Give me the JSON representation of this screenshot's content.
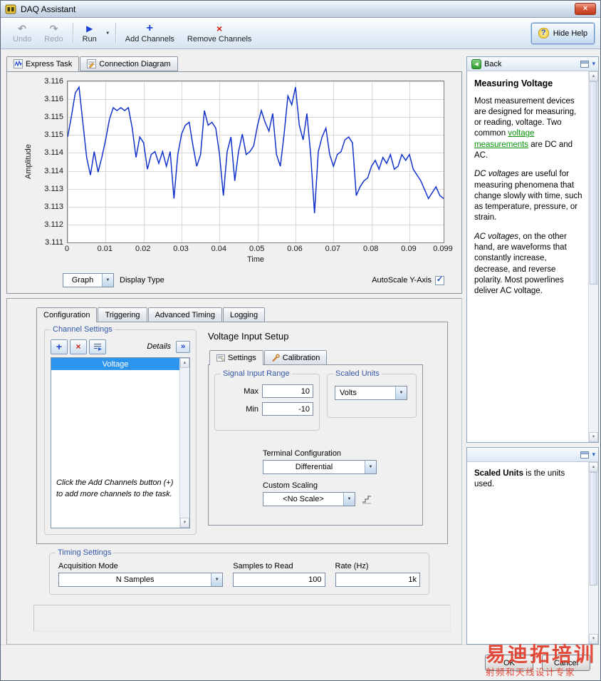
{
  "window": {
    "title": "DAQ Assistant"
  },
  "icons": {
    "undo": "↶",
    "redo": "↷",
    "run": "▶",
    "caret_down": "▼",
    "plus": "+",
    "x": "×",
    "question": "?",
    "back": "◀",
    "check": "✓",
    "chevron_collapse": "▾",
    "details_expand": "»",
    "close": "×",
    "scroll_up": "▲",
    "scroll_down": "▼"
  },
  "colors": {
    "selection_blue": "#2e95ef",
    "group_title_blue": "#3357a8",
    "link_green": "#089408",
    "chart_line_blue": "#1133cc",
    "watermark_red": "#e23220",
    "run_blue": "#1a3fd4",
    "remove_red": "#d02010"
  },
  "toolbar": {
    "undo": "Undo",
    "redo": "Redo",
    "run": "Run",
    "add_channels": "Add Channels",
    "remove_channels": "Remove Channels",
    "hide_help": "Hide Help"
  },
  "express_tabs": {
    "express_task": "Express Task",
    "connection_diagram": "Connection Diagram"
  },
  "graph": {
    "display_type_value": "Graph",
    "display_type_label": "Display Type",
    "autoscale_label": "AutoScale Y-Axis"
  },
  "chart_data": {
    "type": "line",
    "title": "",
    "xlabel": "Time",
    "ylabel": "Amplitude",
    "x_ticks": [
      "0",
      "0.01",
      "0.02",
      "0.03",
      "0.04",
      "0.05",
      "0.06",
      "0.07",
      "0.08",
      "0.09",
      "0.099"
    ],
    "y_ticks": [
      "3.116",
      "3.116",
      "3.115",
      "3.115",
      "3.114",
      "3.114",
      "3.113",
      "3.113",
      "3.112",
      "3.111"
    ],
    "xlim": [
      0,
      0.099
    ],
    "ylim": [
      3.111,
      3.1165
    ],
    "x_step": 0.001,
    "grid": true,
    "grid_color": "#d8d8d8",
    "line_color": "#1133cc",
    "legend": "none",
    "values": [
      3.1146,
      3.1153,
      3.1161,
      3.1163,
      3.1151,
      3.1139,
      3.1133,
      3.1141,
      3.1134,
      3.1139,
      3.1145,
      3.1152,
      3.1156,
      3.1155,
      3.1156,
      3.1155,
      3.1156,
      3.1149,
      3.1139,
      3.1146,
      3.1144,
      3.1135,
      3.114,
      3.1141,
      3.1137,
      3.1141,
      3.1136,
      3.1141,
      3.1125,
      3.114,
      3.1147,
      3.115,
      3.1151,
      3.1143,
      3.1136,
      3.114,
      3.1155,
      3.115,
      3.1151,
      3.1149,
      3.114,
      3.1126,
      3.1141,
      3.1146,
      3.1131,
      3.1141,
      3.1147,
      3.114,
      3.1141,
      3.1143,
      3.115,
      3.1155,
      3.1151,
      3.1148,
      3.1154,
      3.114,
      3.1136,
      3.1147,
      3.116,
      3.1157,
      3.1163,
      3.115,
      3.1145,
      3.1154,
      3.114,
      3.112,
      3.1141,
      3.1146,
      3.1149,
      3.114,
      3.1136,
      3.114,
      3.1141,
      3.1145,
      3.1146,
      3.1144,
      3.1126,
      3.1129,
      3.1131,
      3.1132,
      3.1136,
      3.1138,
      3.1135,
      3.1139,
      3.1137,
      3.114,
      3.1135,
      3.1136,
      3.114,
      3.1138,
      3.114,
      3.1135,
      3.1133,
      3.1131,
      3.1128,
      3.1125,
      3.1127,
      3.1129,
      3.1126,
      3.1125
    ]
  },
  "help": {
    "back": "Back",
    "title": "Measuring Voltage",
    "p1_a": "Most measurement devices are designed for measuring, or reading, voltage. Two common ",
    "p1_link": "voltage measurements",
    "p1_b": " are DC and AC.",
    "p2_i": "DC voltages",
    "p2": " are useful for measuring phenomena that change slowly with time, such as temperature, pressure, or strain.",
    "p3_i": "AC voltages",
    "p3": ", on the other hand, are waveforms that constantly increase, decrease, and reverse polarity. Most powerlines deliver AC voltage."
  },
  "context_help": {
    "bold": "Scaled Units",
    "text": " is the units used."
  },
  "config": {
    "tabs": [
      "Configuration",
      "Triggering",
      "Advanced Timing",
      "Logging"
    ],
    "active_tab": "Configuration",
    "channel_settings": {
      "title": "Channel Settings",
      "details": "Details",
      "channel": "Voltage",
      "hint": "Click the Add Channels button (+) to add more channels to the task."
    },
    "voltage_input_setup": {
      "title": "Voltage Input Setup",
      "tabs": [
        "Settings",
        "Calibration"
      ],
      "signal_input_range": {
        "title": "Signal Input Range",
        "max_label": "Max",
        "max_value": "10",
        "min_label": "Min",
        "min_value": "-10"
      },
      "scaled_units": {
        "title": "Scaled Units",
        "value": "Volts"
      },
      "terminal_configuration": {
        "label": "Terminal Configuration",
        "value": "Differential"
      },
      "custom_scaling": {
        "label": "Custom Scaling",
        "value": "<No Scale>"
      }
    },
    "timing_settings": {
      "title": "Timing Settings",
      "acquisition_mode_label": "Acquisition Mode",
      "acquisition_mode_value": "N Samples",
      "samples_label": "Samples to Read",
      "samples_value": "100",
      "rate_label": "Rate (Hz)",
      "rate_value": "1k"
    }
  },
  "footer": {
    "ok": "OK",
    "cancel": "Cancel"
  },
  "watermark": {
    "line1": "易迪拓培训",
    "line2": "射频和天线设计专家"
  }
}
